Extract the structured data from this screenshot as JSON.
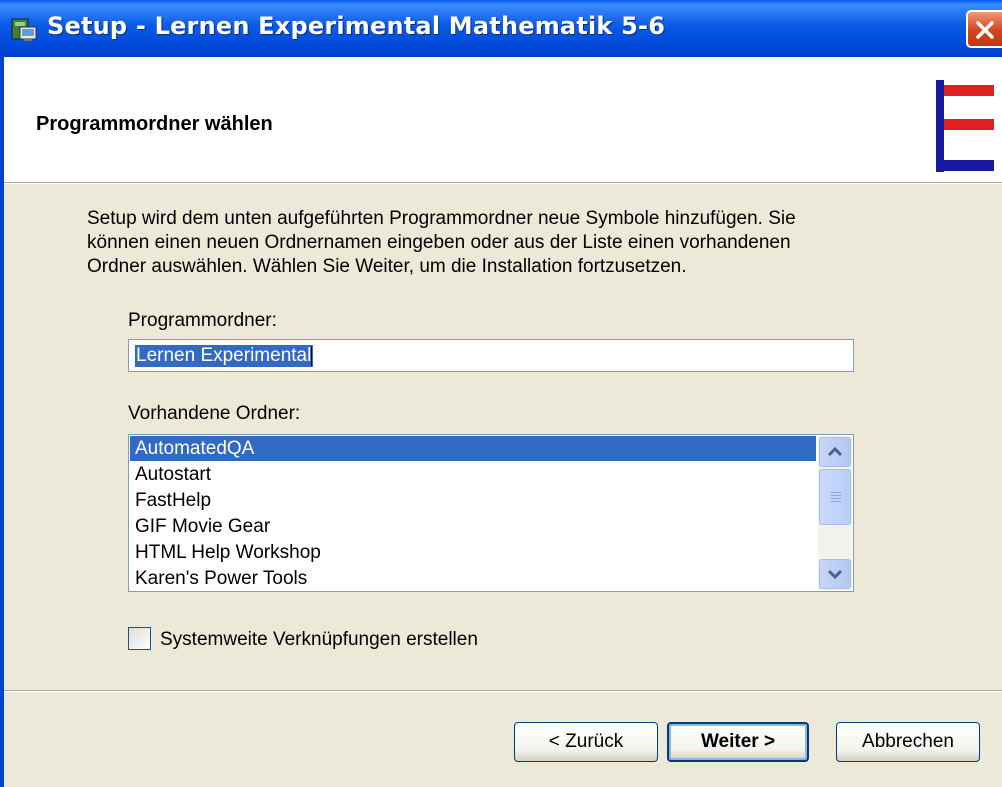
{
  "window": {
    "title": "Setup - Lernen Experimental Mathematik 5-6"
  },
  "header": {
    "title": "Programmordner wählen"
  },
  "description": {
    "line1": "Setup wird dem unten aufgeführten Programmordner neue Symbole hinzufügen. Sie",
    "line2": "können einen neuen Ordnernamen eingeben oder aus der Liste einen vorhandenen",
    "line3": "Ordner auswählen.  Wählen Sie Weiter, um die Installation fortzusetzen."
  },
  "program_folder": {
    "label": "Programmordner:",
    "value": "Lernen Experimental"
  },
  "existing_folders": {
    "label": "Vorhandene Ordner:",
    "items": [
      {
        "label": "AutomatedQA",
        "selected": true
      },
      {
        "label": "Autostart",
        "selected": false
      },
      {
        "label": "FastHelp",
        "selected": false
      },
      {
        "label": "GIF Movie Gear",
        "selected": false
      },
      {
        "label": "HTML Help Workshop",
        "selected": false
      },
      {
        "label": "Karen's Power Tools",
        "selected": false
      }
    ]
  },
  "system_shortcuts": {
    "label": "Systemweite Verknüpfungen erstellen",
    "checked": false
  },
  "buttons": {
    "back": "< Zurück",
    "next": "Weiter >",
    "cancel": "Abbrechen"
  },
  "colors": {
    "title_bar": "#0A5BE6",
    "selection": "#316AC5",
    "logo_red": "#E02020",
    "logo_blue": "#1A1A9E"
  }
}
